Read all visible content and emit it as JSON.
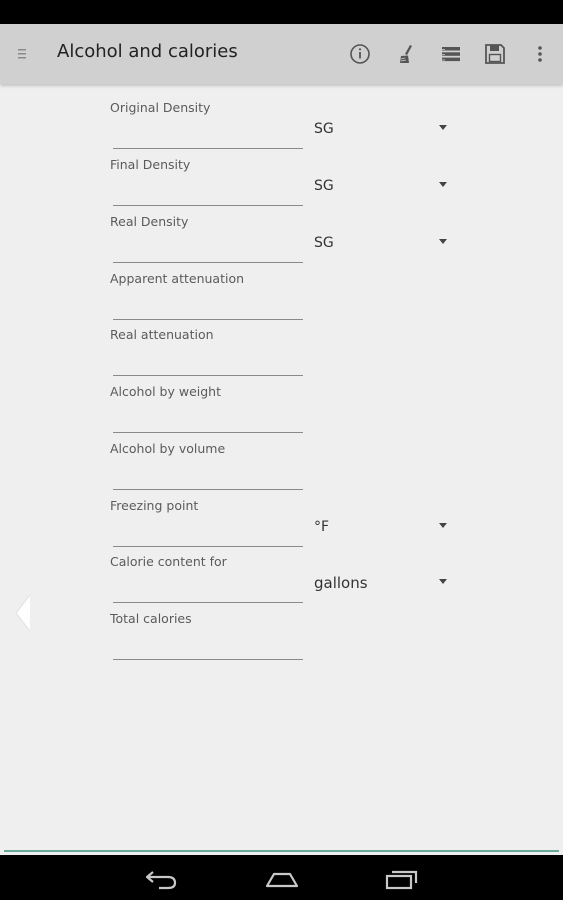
{
  "action_bar": {
    "title": "Alcohol and calories",
    "icons": [
      "drawer-icon",
      "info-icon",
      "clear-icon",
      "list-icon",
      "save-icon",
      "overflow-menu-icon"
    ]
  },
  "form": {
    "fields": [
      {
        "label": "Original Density",
        "value": "",
        "unit": "SG"
      },
      {
        "label": "Final Density",
        "value": "",
        "unit": "SG"
      },
      {
        "label": "Real Density",
        "value": "",
        "unit": "SG"
      },
      {
        "label": "Apparent attenuation",
        "value": ""
      },
      {
        "label": "Real attenuation",
        "value": ""
      },
      {
        "label": "Alcohol by weight",
        "value": ""
      },
      {
        "label": "Alcohol by volume",
        "value": ""
      },
      {
        "label": "Freezing point",
        "value": "",
        "unit": "°F"
      },
      {
        "label": "Calorie content for",
        "value": "",
        "unit": "gallons"
      },
      {
        "label": "Total calories",
        "value": ""
      }
    ]
  },
  "nav_bar": {
    "icons": [
      "back-icon",
      "home-icon",
      "recent-apps-icon"
    ]
  },
  "colors": {
    "action_bar": "#d0d0d0",
    "background": "#efefef",
    "accent_line": "#6aa99a"
  }
}
